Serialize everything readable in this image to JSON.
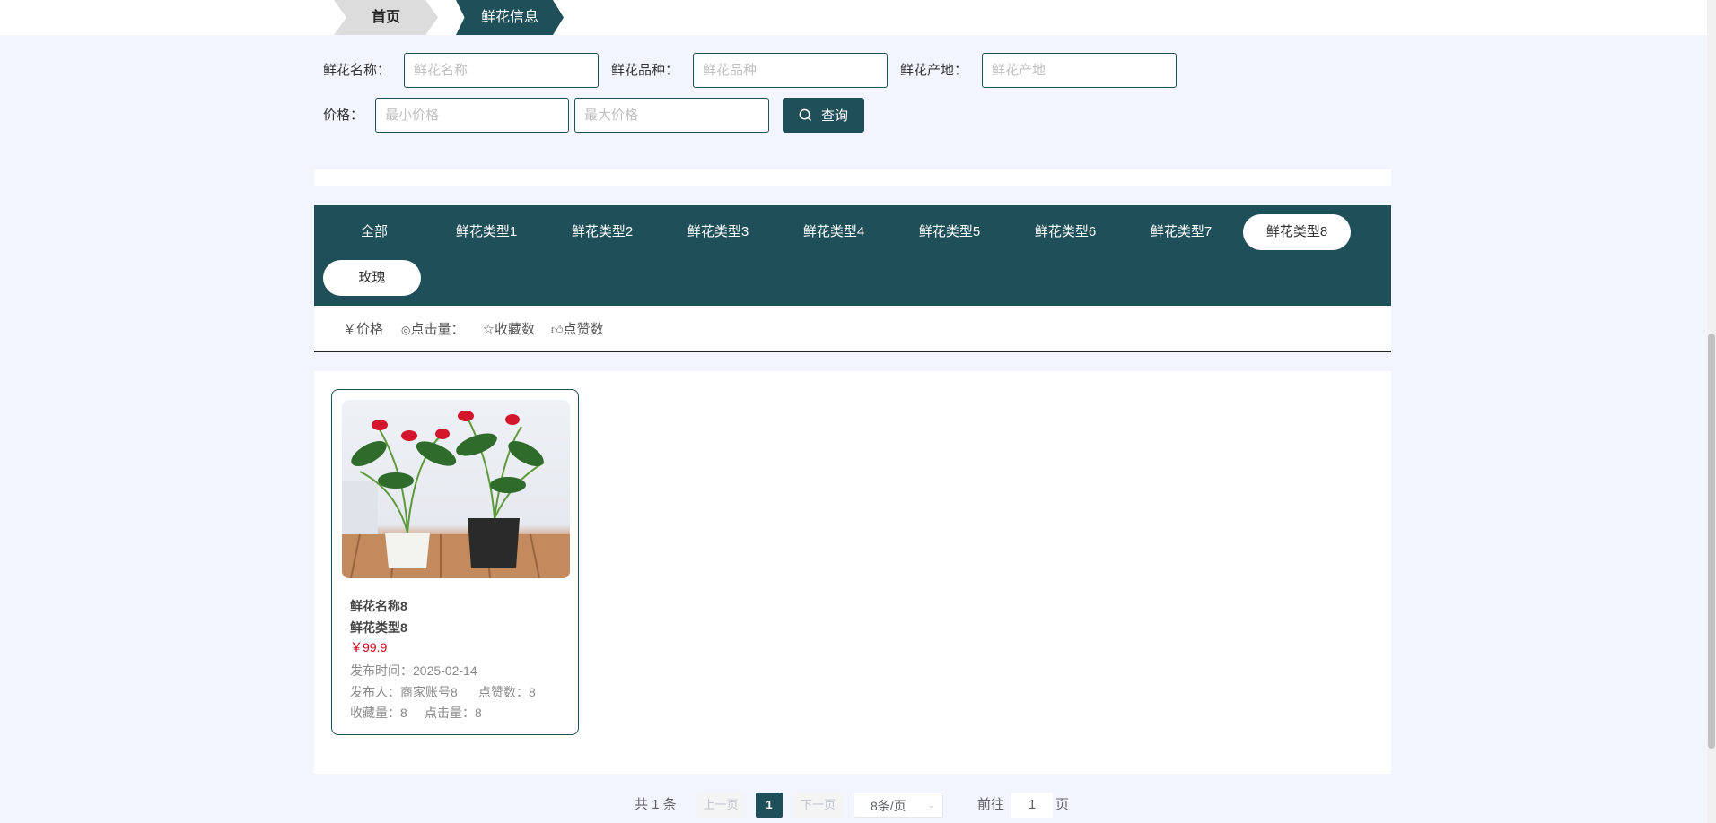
{
  "breadcrumb": {
    "home": "首页",
    "current": "鲜花信息"
  },
  "search": {
    "name_label": "鲜花名称：",
    "name_placeholder": "鲜花名称",
    "variety_label": "鲜花品种：",
    "variety_placeholder": "鲜花品种",
    "origin_label": "鲜花产地：",
    "origin_placeholder": "鲜花产地",
    "price_label": "价格：",
    "min_placeholder": "最小价格",
    "max_placeholder": "最大价格",
    "query_label": "查询"
  },
  "categories": {
    "active": "鲜花类型8",
    "hover": "玫瑰",
    "items": [
      "全部",
      "鲜花类型1",
      "鲜花类型2",
      "鲜花类型3",
      "鲜花类型4",
      "鲜花类型5",
      "鲜花类型6",
      "鲜花类型7",
      "鲜花类型8",
      "玫瑰"
    ]
  },
  "sort": {
    "price": "￥价格",
    "clicks": "点击量：",
    "favorites": "收藏数",
    "likes": "点赞数"
  },
  "products": [
    {
      "name": "鲜花名称8",
      "type": "鲜花类型8",
      "price": "￥99.9",
      "publish_time": "发布时间：2025-02-14",
      "publisher": "发布人：商家账号8",
      "likes": "点赞数：8",
      "favorites": "收藏量：8",
      "clicks": "点击量：8"
    }
  ],
  "pagination": {
    "total": "共 1 条",
    "prev": "上一页",
    "page": "1",
    "next": "下一页",
    "page_size": "8条/页",
    "goto_label": "前往",
    "goto_value": "1",
    "goto_suffix": "页"
  },
  "colors": {
    "primary": "#1f4f58",
    "price": "#d0021b",
    "background": "#f2f5fd"
  }
}
